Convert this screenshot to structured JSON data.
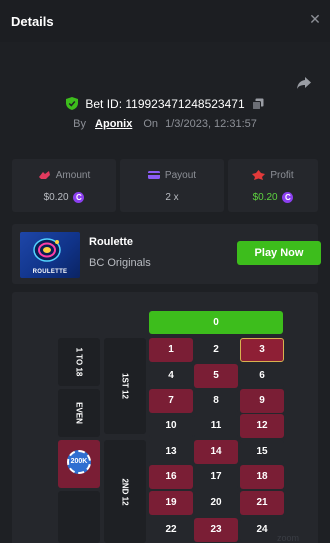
{
  "header": {
    "title": "Details",
    "close_icon": "close-icon"
  },
  "bet": {
    "id_label": "Bet ID: 119923471248523471",
    "by_label": "By",
    "user": "Aponix",
    "on_label": "On",
    "date": "1/3/2023, 12:31:57"
  },
  "stats": {
    "amount": {
      "label": "Amount",
      "value": "$0.20"
    },
    "payout": {
      "label": "Payout",
      "value": "2 x"
    },
    "profit": {
      "label": "Profit",
      "value": "$0.20"
    }
  },
  "coin_symbol": "C",
  "game": {
    "thumb_label": "ROULETTE",
    "name": "Roulette",
    "provider": "BC Originals",
    "play_label": "Play Now"
  },
  "board": {
    "zero": "0",
    "numbers": [
      {
        "n": "1",
        "color": "red"
      },
      {
        "n": "2",
        "color": "black"
      },
      {
        "n": "3",
        "color": "red",
        "hit": true
      },
      {
        "n": "4",
        "color": "black"
      },
      {
        "n": "5",
        "color": "red"
      },
      {
        "n": "6",
        "color": "black"
      },
      {
        "n": "7",
        "color": "red"
      },
      {
        "n": "8",
        "color": "black"
      },
      {
        "n": "9",
        "color": "red"
      },
      {
        "n": "10",
        "color": "black"
      },
      {
        "n": "11",
        "color": "black"
      },
      {
        "n": "12",
        "color": "red"
      },
      {
        "n": "13",
        "color": "black"
      },
      {
        "n": "14",
        "color": "red"
      },
      {
        "n": "15",
        "color": "black"
      },
      {
        "n": "16",
        "color": "red"
      },
      {
        "n": "17",
        "color": "black"
      },
      {
        "n": "18",
        "color": "red"
      },
      {
        "n": "19",
        "color": "red"
      },
      {
        "n": "20",
        "color": "black"
      },
      {
        "n": "21",
        "color": "red"
      },
      {
        "n": "22",
        "color": "black"
      },
      {
        "n": "23",
        "color": "red"
      },
      {
        "n": "24",
        "color": "black"
      }
    ],
    "dozen_1": "1ST 12",
    "dozen_2": "2ND 12",
    "outside_1to18": "1 TO 18",
    "outside_even": "EVEN",
    "chip_label": "200K"
  },
  "watermark": "zoom"
}
